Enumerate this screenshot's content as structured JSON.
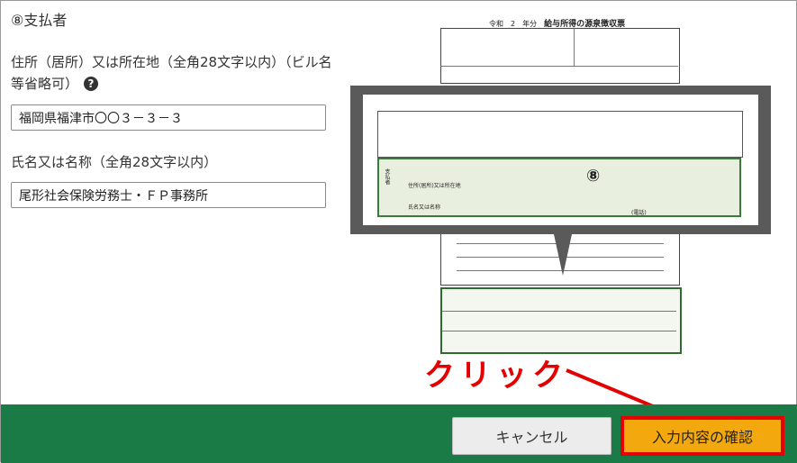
{
  "section": {
    "title": "⑧支払者"
  },
  "address": {
    "label": "住所（居所）又は所在地（全角28文字以内）（ビル名等省略可）",
    "help": "?",
    "value": "福岡県福津市〇〇３－３－３"
  },
  "name": {
    "label": "氏名又は名称（全角28文字以内）",
    "value": "尾形社会保険労務士・ＦＰ事務所"
  },
  "form_image": {
    "title_prefix": "令和　2　年分",
    "title": "給与所得の源泉徴収票",
    "callout_number": "⑧",
    "row_label_1": "住所(居所)又は所在地",
    "row_label_2": "氏名又は名称",
    "side_label": "支払者",
    "tel": "(電話)"
  },
  "annotation": {
    "text": "クリック",
    "color": "#e40000"
  },
  "footer": {
    "cancel_label": "キャンセル",
    "confirm_label": "入力内容の確認",
    "bg_color": "#1b7b46",
    "confirm_color": "#f3a90e"
  }
}
